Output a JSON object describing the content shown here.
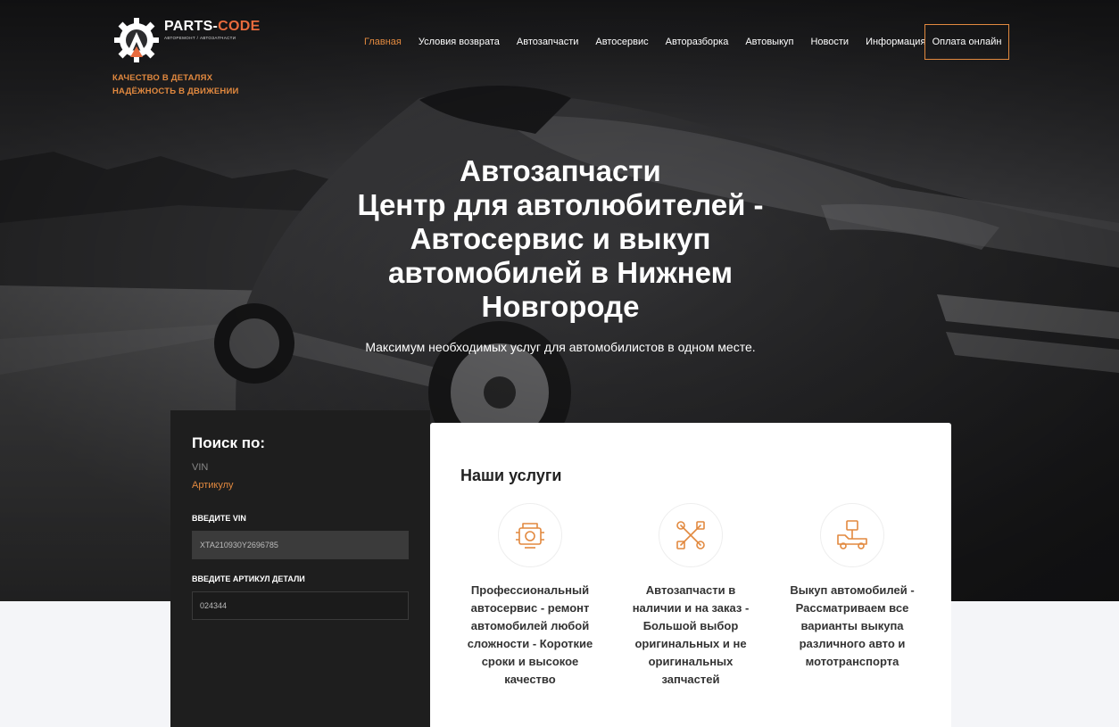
{
  "brand": {
    "name_main": "PARTS-",
    "name_accent": "CODE",
    "tagline": "АВТОРЕМОНТ / АВТОЗАПЧАСТИ",
    "slogan": [
      "КАЧЕСТВО В ДЕТАЛЯХ",
      "НАДЁЖНОСТЬ В ДВИЖЕНИИ"
    ],
    "accent_color": "#e2893f"
  },
  "nav": {
    "items": [
      "Главная",
      "Условия возврата",
      "Автозапчасти",
      "Автосервис",
      "Авторазборка",
      "Автовыкуп",
      "Новости",
      "Информация"
    ],
    "active": "Главная",
    "pay_button": "Оплата онлайн"
  },
  "hero": {
    "title_lines": [
      "Автозапчасти",
      "Центр для автолюбителей -",
      "Автосервис и выкуп",
      "автомобилей в Нижнем",
      "Новгороде"
    ],
    "subtitle": "Максимум необходимых услуг для автомобилистов в одном месте."
  },
  "search": {
    "heading": "Поиск по:",
    "option_vin": "VIN",
    "option_article": "Артикулу",
    "vin_label": "ВВЕДИТЕ VIN",
    "vin_value": "XTA210930Y2696785",
    "article_label": "ВВЕДИТЕ АРТИКУЛ ДЕТАЛИ",
    "article_value": "024344"
  },
  "services": {
    "heading": "Наши услуги",
    "items": [
      {
        "icon": "engine-icon",
        "lines": [
          "Профессиональный",
          "автосервис - ремонт",
          "автомобилей любой",
          "сложности - Короткие",
          "сроки и высокое",
          "качество"
        ]
      },
      {
        "icon": "tools-icon",
        "lines": [
          "Автозапчасти в",
          "наличии и на заказ -",
          "Большой выбор",
          "оригинальных и не",
          "оригинальных",
          "запчастей"
        ]
      },
      {
        "icon": "tow-truck-icon",
        "lines": [
          "Выкуп автомобилей -",
          "Рассматриваем все",
          "варианты выкупа",
          "различного авто и",
          "мототранспорта"
        ]
      }
    ]
  }
}
